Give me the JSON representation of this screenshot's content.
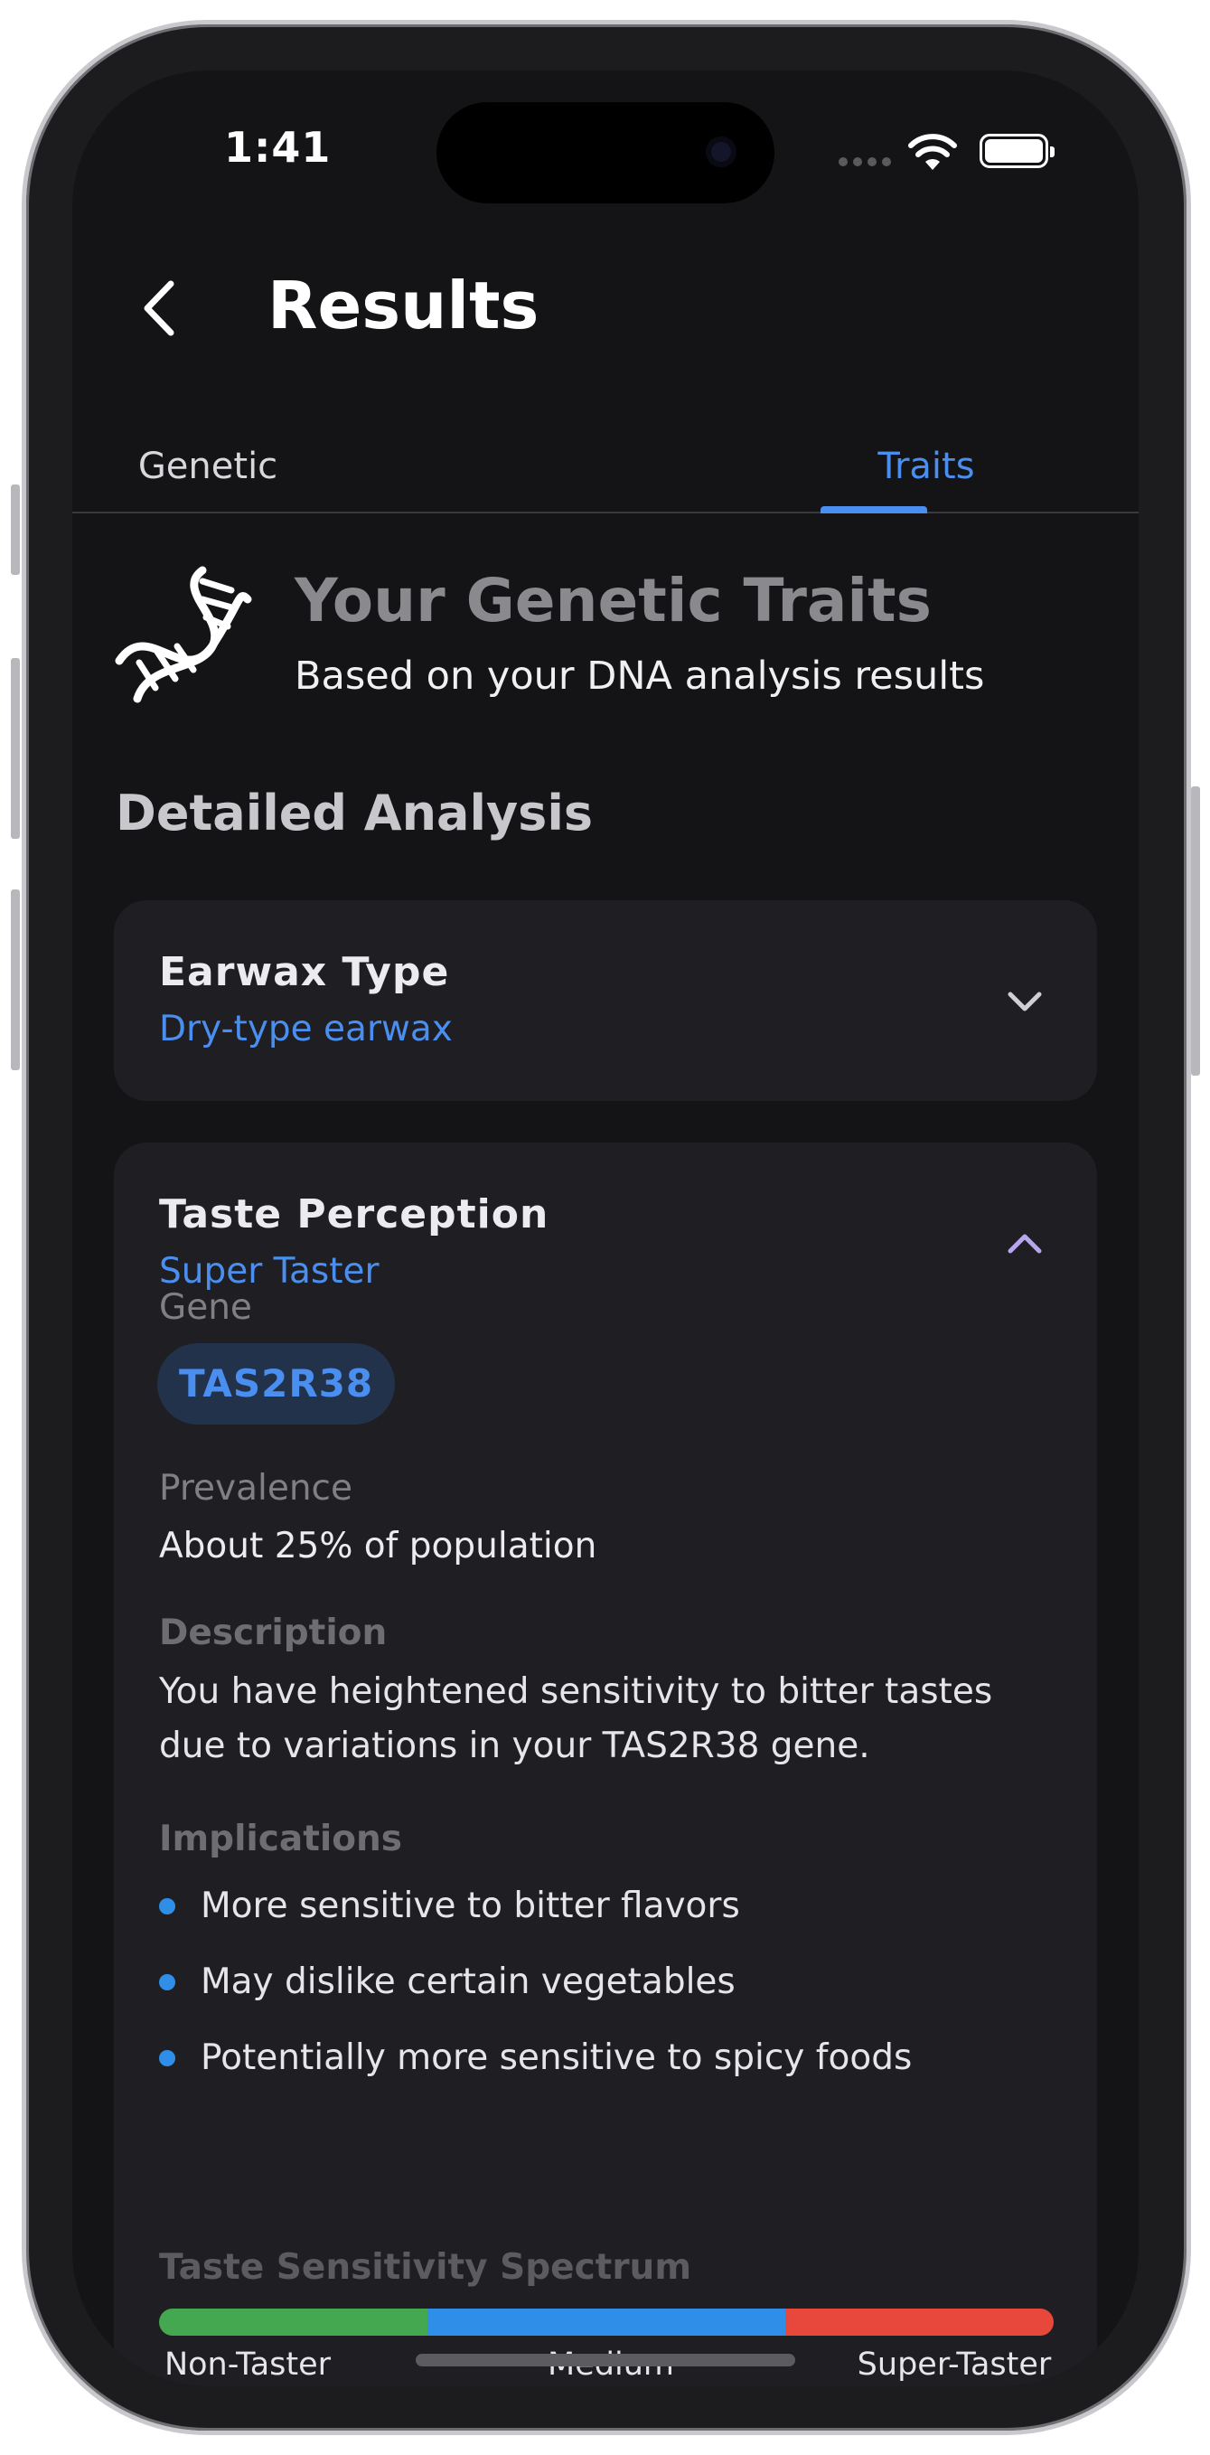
{
  "status_bar": {
    "time": "1:41"
  },
  "header": {
    "title": "Results"
  },
  "tabs": [
    {
      "label": "Genetic",
      "active": false
    },
    {
      "label": "Traits",
      "active": true
    }
  ],
  "hero": {
    "title": "Your Genetic Traits",
    "subtitle": "Based on your DNA analysis results",
    "icon": "dna-icon"
  },
  "section_title": "Detailed Analysis",
  "cards": [
    {
      "title": "Earwax Type",
      "result": "Dry-type earwax",
      "expanded": false
    },
    {
      "title": "Taste Perception",
      "result": "Super Taster",
      "expanded": true,
      "gene_label": "Gene",
      "gene": "TAS2R38",
      "prevalence_label": "Prevalence",
      "prevalence": "About 25% of population",
      "description_label": "Description",
      "description": "You have heightened sensitivity to bitter tastes due to variations in your TAS2R38 gene.",
      "implications_label": "Implications",
      "implications": [
        "More sensitive to bitter flavors",
        "May dislike certain vegetables",
        "Potentially more sensitive to spicy foods"
      ],
      "spectrum_label": "Taste Sensitivity Spectrum",
      "spectrum": [
        {
          "label": "Non-Taster",
          "color": "#43a84f",
          "share": 0.3
        },
        {
          "label": "Medium",
          "color": "#2f8fe8",
          "share": 0.4
        },
        {
          "label": "Super-Taster",
          "color": "#e8483c",
          "share": 0.3
        }
      ]
    }
  ],
  "colors": {
    "accent": "#4a8ff0",
    "background": "#141416",
    "card": "#1f1f23"
  }
}
